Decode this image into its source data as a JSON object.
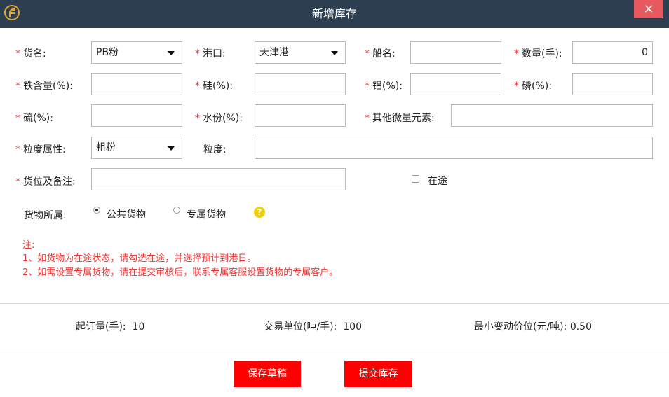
{
  "window": {
    "title": "新增库存",
    "close_label": "×"
  },
  "form": {
    "goods_name": {
      "label": "货名:",
      "value": "PB粉"
    },
    "port": {
      "label": "港口:",
      "value": "天津港"
    },
    "ship_name": {
      "label": "船名:",
      "value": ""
    },
    "quantity": {
      "label": "数量(手):",
      "value": "0"
    },
    "iron": {
      "label": "铁含量(%):",
      "value": ""
    },
    "silicon": {
      "label": "硅(%):",
      "value": ""
    },
    "aluminum": {
      "label": "铝(%):",
      "value": ""
    },
    "phosphorus": {
      "label": "磷(%):",
      "value": ""
    },
    "sulfur": {
      "label": "硫(%):",
      "value": ""
    },
    "moisture": {
      "label": "水份(%):",
      "value": ""
    },
    "trace_elements": {
      "label": "其他微量元素:",
      "value": ""
    },
    "granularity_attr": {
      "label": "粒度属性:",
      "value": "粗粉"
    },
    "granularity": {
      "label": "粒度:",
      "value": ""
    },
    "location_remark": {
      "label": "货位及备注:",
      "value": ""
    },
    "in_transit": {
      "label": "在途",
      "checked": false
    },
    "ownership": {
      "label": "货物所属:",
      "options": [
        {
          "label": "公共货物",
          "selected": true
        },
        {
          "label": "专属货物",
          "selected": false
        }
      ],
      "help_icon": "?"
    },
    "required_mark": "*"
  },
  "notes": {
    "title": "注:",
    "lines": [
      "1、如货物为在途状态，请勾选在途，并选择预计到港日。",
      "2、如需设置专属货物，请在提交审核后，联系专属客服设置货物的专属客户。"
    ]
  },
  "trade_info": {
    "min_order": {
      "label": "起订量(手):",
      "value": "10"
    },
    "unit": {
      "label": "交易单位(吨/手):",
      "value": "100"
    },
    "min_tick": {
      "label": "最小变动价位(元/吨):",
      "value": "0.50"
    }
  },
  "buttons": {
    "save_draft": "保存草稿",
    "submit": "提交库存"
  },
  "colors": {
    "titlebar": "#2c3e50",
    "close": "#e65a5f",
    "required": "#ee3333",
    "button": "#ff0000",
    "help": "#f0d000"
  }
}
